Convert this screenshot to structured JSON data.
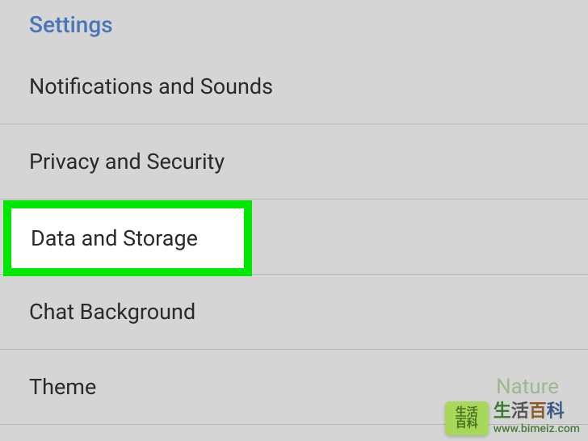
{
  "section_header": "Settings",
  "items": [
    {
      "label": "Notifications and Sounds"
    },
    {
      "label": "Privacy and Security"
    },
    {
      "label": "Data and Storage"
    },
    {
      "label": "Chat Background"
    },
    {
      "label": "Theme",
      "value": "Nature"
    }
  ],
  "highlighted_label": "Data and Storage",
  "watermark": {
    "icon_top": "生活",
    "icon_bottom": "百科",
    "cn": "生活百科",
    "url": "www.bimeiz.com"
  }
}
